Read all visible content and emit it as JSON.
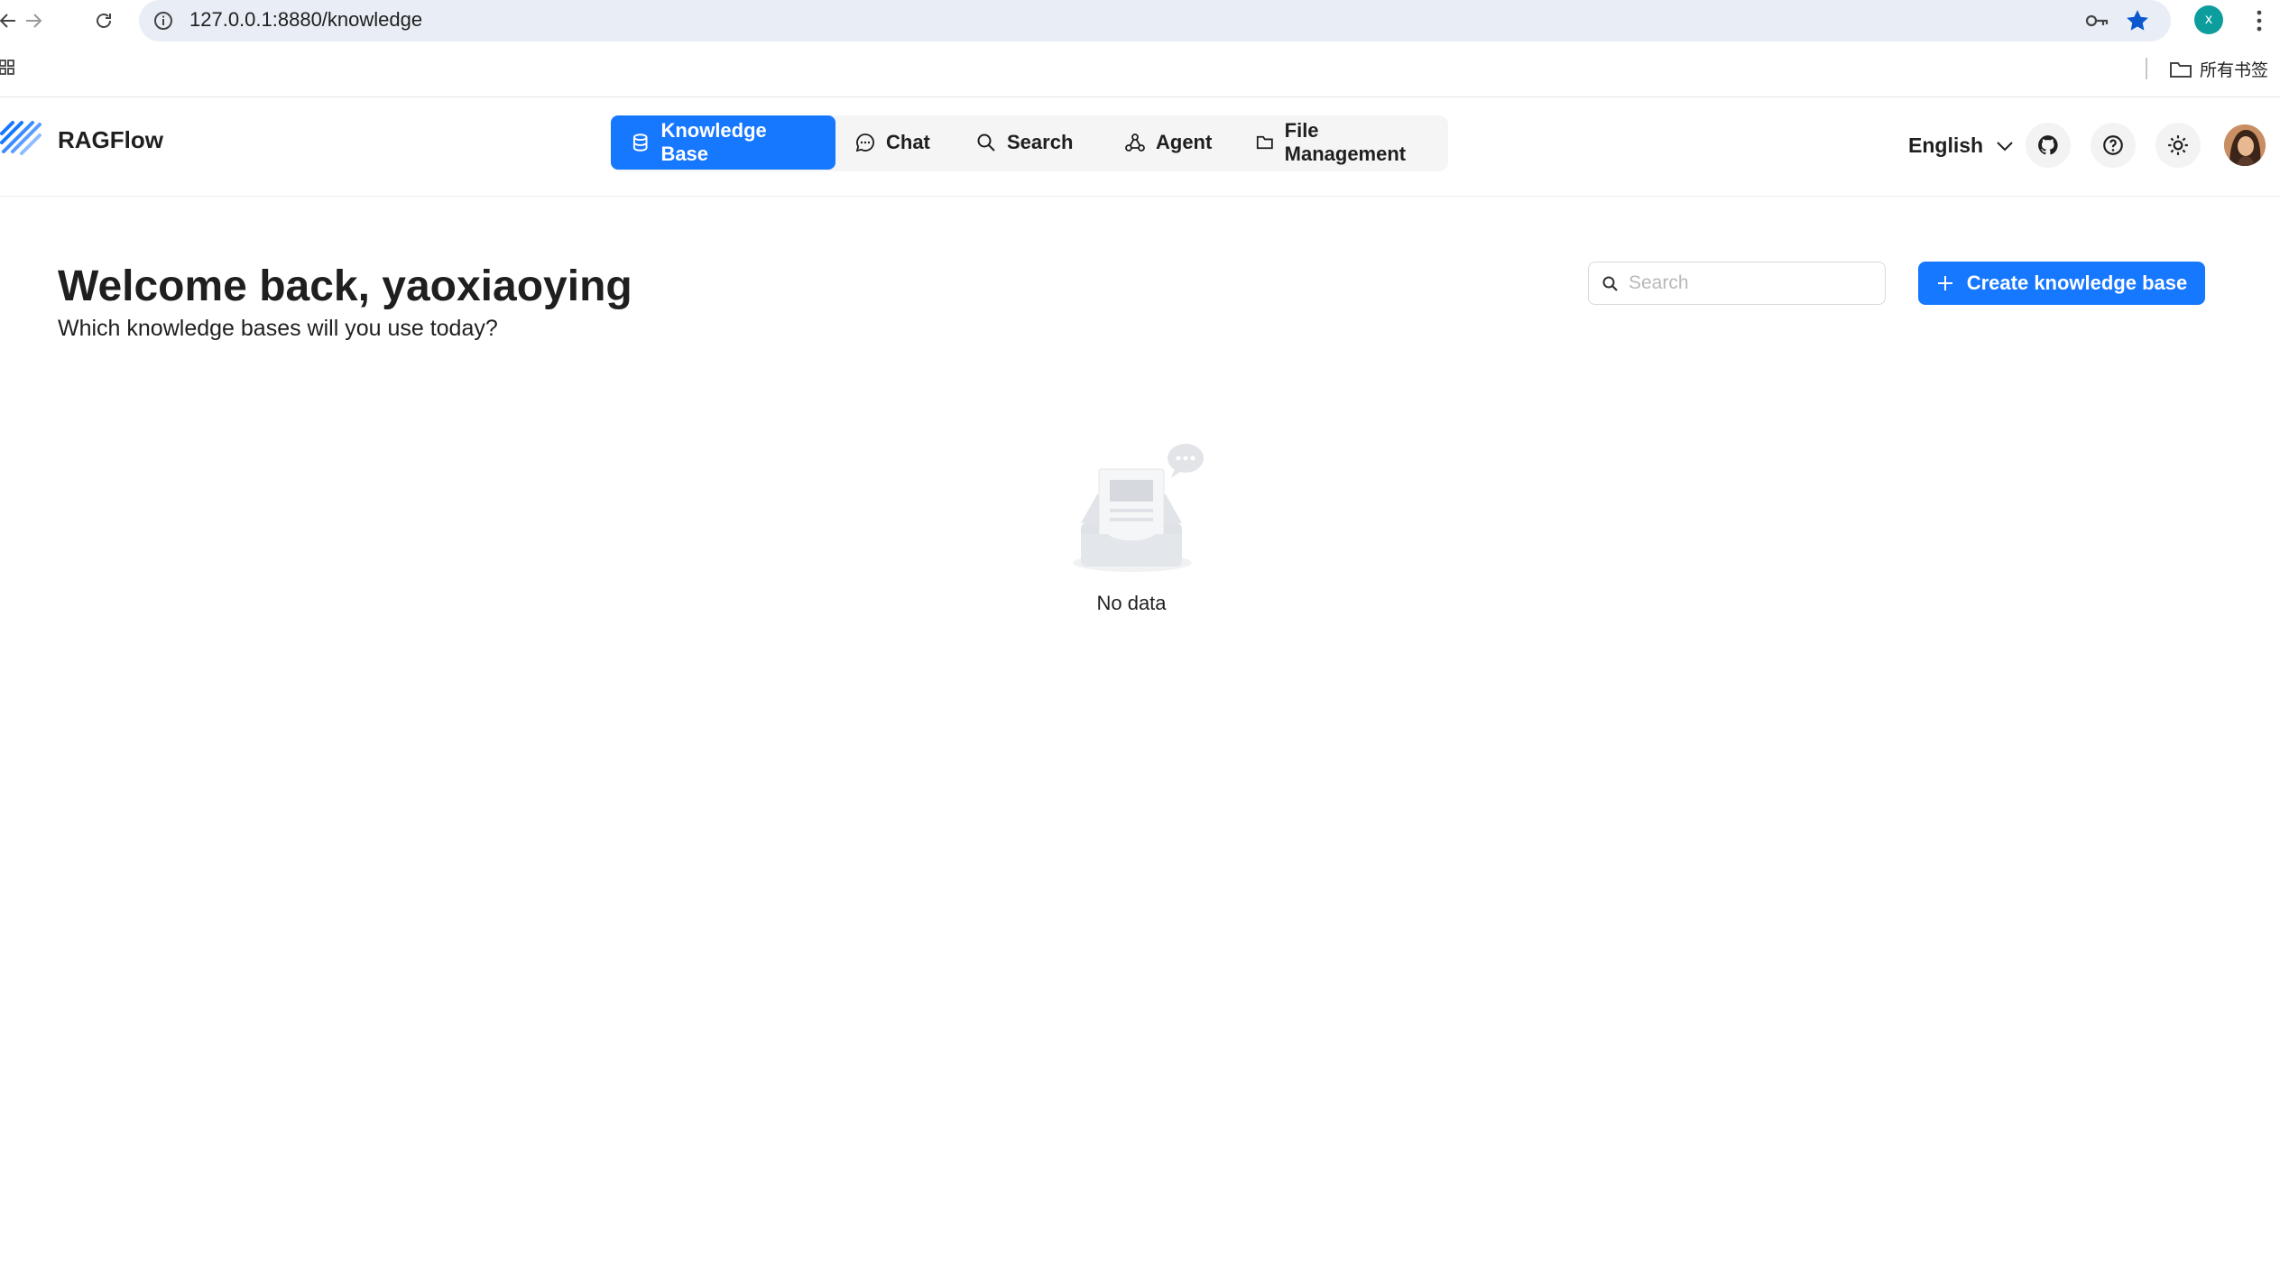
{
  "browser": {
    "url": "127.0.0.1:8880/knowledge",
    "profile_initial": "x",
    "bookmarks_folder": "所有书签"
  },
  "header": {
    "brand": "RAGFlow",
    "nav": [
      {
        "label": "Knowledge Base",
        "icon": "database-icon",
        "active": true
      },
      {
        "label": "Chat",
        "icon": "chat-icon",
        "active": false
      },
      {
        "label": "Search",
        "icon": "search-icon",
        "active": false
      },
      {
        "label": "Agent",
        "icon": "agent-icon",
        "active": false
      },
      {
        "label": "File Management",
        "icon": "folder-icon",
        "active": false
      }
    ],
    "language": "English"
  },
  "main": {
    "title": "Welcome back, yaoxiaoying",
    "subtitle": "Which knowledge bases will you use today?",
    "search_placeholder": "Search",
    "create_label": "Create knowledge base",
    "empty_text": "No data"
  },
  "colors": {
    "accent": "#1677ff",
    "nav_bg": "#f5f5f5",
    "omnibox_bg": "#e9eef6"
  }
}
